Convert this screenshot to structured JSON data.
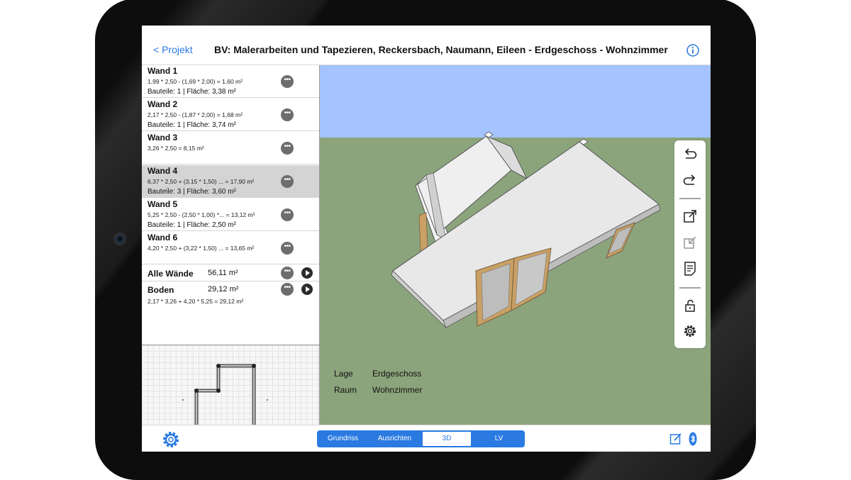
{
  "header": {
    "back_label": "< Projekt",
    "title": "BV: Malerarbeiten und Tapezieren, Reckersbach, Naumann, Eileen - Erdgeschoss - Wohnzimmer",
    "info_icon": "info-icon"
  },
  "walls": [
    {
      "name": "Wand 1",
      "formula": "1,99 * 2,50  - (1,69 * 2,00)   = 1,60 m²",
      "detail": "Bauteile: 1 | Fläche: 3,38 m²",
      "selected": false
    },
    {
      "name": "Wand 2",
      "formula": "2,17 * 2,50  - (1,87 * 2,00)   = 1,68 m²",
      "detail": "Bauteile: 1 | Fläche: 3,74 m²",
      "selected": false
    },
    {
      "name": "Wand 3",
      "formula": "3,26 * 2,50   = 8,15 m²",
      "detail": "",
      "selected": false
    },
    {
      "name": "Wand 4",
      "formula": "6,37 * 2,50   + (3,15 * 1,50) ... = 17,90 m²",
      "detail": "Bauteile: 3 | Fläche: 3,60 m²",
      "selected": true
    },
    {
      "name": "Wand 5",
      "formula": "5,25 * 2,50  - (2,50 * 1,00) *... = 13,12 m²",
      "detail": "Bauteile: 1 | Fläche: 2,50 m²",
      "selected": false
    },
    {
      "name": "Wand 6",
      "formula": "4,20 * 2,50   + (3,22 * 1,50) ... = 13,65 m²",
      "detail": "",
      "selected": false
    }
  ],
  "more_label": "•••",
  "totals": {
    "all_walls_label": "Alle Wände",
    "all_walls_value": "56,11 m²",
    "floor_label": "Boden",
    "floor_value": "29,12 m²",
    "floor_formula": "2,17 * 3,26  + 4,20 * 5,25  = 29,12 m²"
  },
  "location": {
    "lage_label": "Lage",
    "lage_value": "Erdgeschoss",
    "raum_label": "Raum",
    "raum_value": "Wohnzimmer"
  },
  "tools": [
    "undo-icon",
    "redo-icon",
    "export-icon",
    "import-icon",
    "document-icon",
    "lock-icon",
    "settings-icon"
  ],
  "segments": [
    {
      "label": "Grundriss",
      "active": false
    },
    {
      "label": "Ausrichten",
      "active": false
    },
    {
      "label": "3D",
      "active": true
    },
    {
      "label": "LV",
      "active": false
    }
  ],
  "colors": {
    "accent": "#2a7ae2",
    "sky": "#a4c3ff",
    "ground": "#8ca47c",
    "selected_row": "#d4d4d4",
    "frame_wood": "#c9a065"
  }
}
